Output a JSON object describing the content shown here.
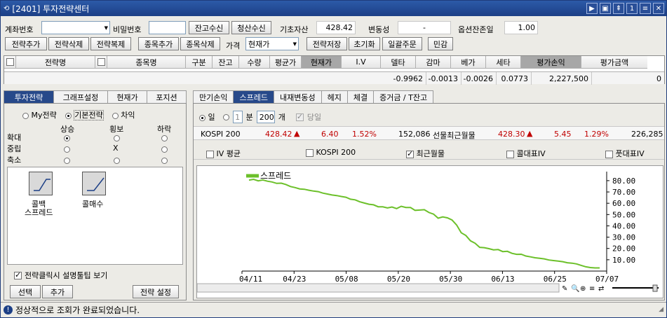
{
  "window": {
    "title": "[2401] 투자전략센터",
    "buttons": [
      "▶",
      "▣",
      "⇞",
      "1",
      "≡",
      "✕"
    ]
  },
  "toolbar": {
    "account_label": "계좌번호",
    "password_label": "비밀번호",
    "balance_btn": "잔고수신",
    "settle_btn": "청산수신",
    "base_asset_label": "기초자산",
    "base_asset_value": "428.42",
    "volatility_label": "변동성",
    "volatility_value": "-",
    "option_balance_label": "옵션잔존일",
    "option_balance_value": "1.00",
    "add_strategy": "전략추가",
    "del_strategy": "전략삭제",
    "copy_strategy": "전략복제",
    "add_item": "종목추가",
    "del_item": "종목삭제",
    "price_label": "가격",
    "price_select": "현재가",
    "save_strategy": "전략저장",
    "reset": "초기화",
    "bulk_order": "일괄주문",
    "sensitivity": "민감"
  },
  "grid": {
    "headers": [
      "",
      "전략명",
      "",
      "종목명",
      "구분",
      "잔고",
      "수량",
      "평균가",
      "현재가",
      "I.V",
      "델타",
      "감마",
      "베가",
      "세타",
      "평가손익",
      "평가금액"
    ],
    "summary": [
      "-0.9962",
      "-0.0013",
      "-0.0026",
      "0.0773",
      "2,227,500",
      "0"
    ]
  },
  "left": {
    "tabs": [
      "투자전략",
      "그래프설정",
      "현재가",
      "포지션"
    ],
    "radios": [
      "My전략",
      "기본전략",
      "차익"
    ],
    "col_heads": [
      "상승",
      "횡보",
      "하락"
    ],
    "row_heads": [
      "확대",
      "중립",
      "축소"
    ],
    "mid_mark": "X",
    "strategies": [
      {
        "label1": "콜백",
        "label2": "스프레드"
      },
      {
        "label1": "콜매수",
        "label2": ""
      }
    ],
    "tooltip_chk": "전략클릭시 설명툴팁 보기",
    "select_btn": "선택",
    "add_btn": "추가",
    "setting_btn": "전략 설정"
  },
  "right": {
    "tabs": [
      "만기손익",
      "스프레드",
      "내재변동성",
      "헤지",
      "체결",
      "증거금 / T잔고"
    ],
    "opt_day": "일",
    "opt_min": "분",
    "min_val1": "1",
    "min_val2": "200",
    "unit": "개",
    "today": "당일",
    "row1": {
      "name": "KOSPI 200",
      "price": "428.42",
      "chg": "6.40",
      "pct": "1.52%",
      "vol": "152,086"
    },
    "row2": {
      "name": "선물최근월물",
      "price": "428.30",
      "chg": "5.45",
      "pct": "1.29%",
      "vol": "226,285"
    },
    "checks": [
      "IV 평균",
      "KOSPI 200",
      "최근월물",
      "콜대표IV",
      "풋대표IV"
    ]
  },
  "status": {
    "message": "정상적으로 조회가 완료되었습니다."
  },
  "chart_data": {
    "type": "line",
    "series": [
      {
        "name": "스프레드",
        "values": [
          80.5,
          81.2,
          79.8,
          80.6,
          79.5,
          78.8,
          77.6,
          77.8,
          76.6,
          74.8,
          73.9,
          72.7,
          72.4,
          71.5,
          70.8,
          70.3,
          69.0,
          68.2,
          67.3,
          66.8,
          66.0,
          65.3,
          63.6,
          63.0,
          61.3,
          60.2,
          59.1,
          58.6,
          56.9,
          56.8,
          55.9,
          56.7,
          55.3,
          57.3,
          56.3,
          56.2,
          53.7,
          54.0,
          54.3,
          51.8,
          50.4,
          46.8,
          47.9,
          47.1,
          45.2,
          40.7,
          33.9,
          31.5,
          26.8,
          24.6,
          21.0,
          20.7,
          19.8,
          18.8,
          19.0,
          17.2,
          17.5,
          15.7,
          14.8,
          14.9,
          13.3,
          12.6,
          11.8,
          11.3,
          10.8,
          9.8,
          9.3,
          8.8,
          8.3,
          7.4,
          7.0,
          6.3,
          5.0,
          3.8,
          3.1,
          2.8,
          2.8
        ]
      }
    ],
    "x_labels": [
      "04/11",
      "04/23",
      "05/08",
      "05/20",
      "05/30",
      "06/13",
      "06/25",
      "07/07"
    ],
    "y_ticks": [
      80,
      70,
      60,
      50,
      40,
      30,
      20,
      10
    ],
    "y_tick_labels": [
      "80.00",
      "70.00",
      "60.00",
      "50.00",
      "40.00",
      "30.00",
      "20.00",
      "10.00"
    ],
    "ylim": [
      0,
      88
    ],
    "legend": "top-left",
    "color": "#6cc02a"
  }
}
